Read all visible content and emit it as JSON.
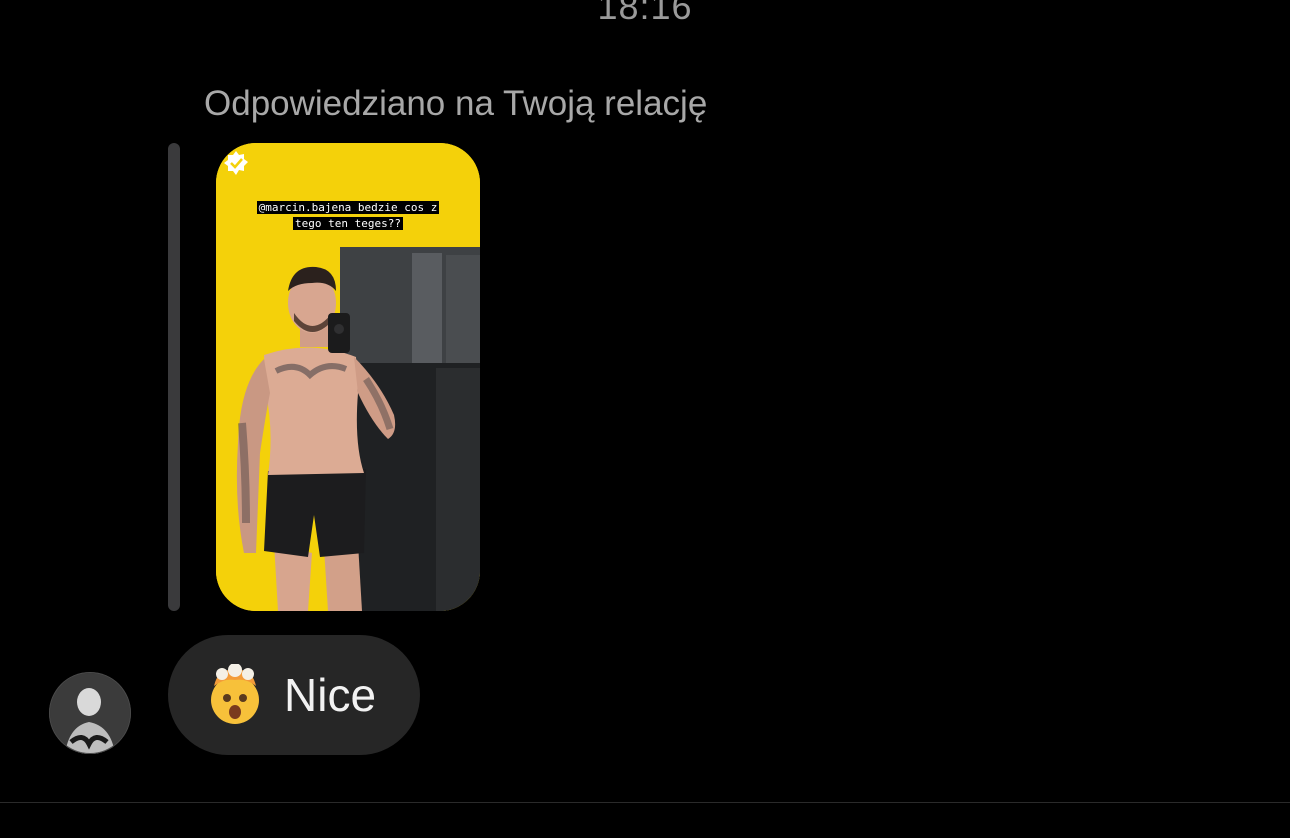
{
  "thread": {
    "timestamp": "18:16",
    "reply_context_label": "Odpowiedziano na Twoją relację"
  },
  "story": {
    "caption_line_1": "@marcin.bajena bedzie cos z",
    "caption_line_2": "tego ten teges??",
    "background_color": "#f5d50b",
    "badge_icon": "sticker-badge-icon"
  },
  "message": {
    "emoji_icon": "exploding-head-emoji",
    "text": "Nice"
  },
  "sender": {
    "avatar_icon": "avatar-photo"
  },
  "colors": {
    "background": "#000000",
    "bubble": "#262626",
    "muted_text": "#a8a8a8",
    "reply_bar": "#3a3a3c"
  }
}
